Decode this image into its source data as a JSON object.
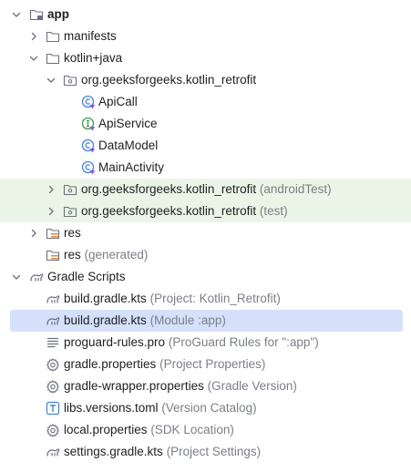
{
  "tree": {
    "app": "app",
    "manifests": "manifests",
    "kotlin_java": "kotlin+java",
    "pkg_main": "org.geeksforgeeks.kotlin_retrofit",
    "api_call": "ApiCall",
    "api_service": "ApiService",
    "data_model": "DataModel",
    "main_activity": "MainActivity",
    "pkg_android_test": "org.geeksforgeeks.kotlin_retrofit",
    "pkg_android_test_hint": "(androidTest)",
    "pkg_test": "org.geeksforgeeks.kotlin_retrofit",
    "pkg_test_hint": "(test)",
    "res": "res",
    "res_generated": "res",
    "res_generated_hint": "(generated)",
    "gradle_scripts": "Gradle Scripts",
    "build_project": "build.gradle.kts",
    "build_project_hint": "(Project: Kotlin_Retrofit)",
    "build_module": "build.gradle.kts",
    "build_module_hint": "(Module :app)",
    "proguard": "proguard-rules.pro",
    "proguard_hint": "(ProGuard Rules for \":app\")",
    "gradle_properties": "gradle.properties",
    "gradle_properties_hint": "(Project Properties)",
    "gradle_wrapper": "gradle-wrapper.properties",
    "gradle_wrapper_hint": "(Gradle Version)",
    "libs_versions": "libs.versions.toml",
    "libs_versions_hint": "(Version Catalog)",
    "local_properties": "local.properties",
    "local_properties_hint": "(SDK Location)",
    "settings_gradle": "settings.gradle.kts",
    "settings_gradle_hint": "(Project Settings)"
  },
  "colors": {
    "selection": "#d5e1fb",
    "test_highlight": "#eaf5e7",
    "hint_text": "#7b7f86",
    "folder_icon": "#6c707e",
    "class_icon": "#4682d9",
    "interface_icon": "#3d9a50",
    "resource_icon": "#e08a3c"
  },
  "icons": {
    "expanded": "chevron-down-icon",
    "collapsed": "chevron-right-icon",
    "module": "module-folder-icon",
    "folder": "folder-icon",
    "package": "package-icon",
    "class": "kotlin-class-icon",
    "interface": "kotlin-interface-icon",
    "resources": "resource-folder-icon",
    "gradle": "gradle-elephant-icon",
    "text_file": "text-file-icon",
    "settings": "gear-icon",
    "toml": "toml-file-icon"
  }
}
